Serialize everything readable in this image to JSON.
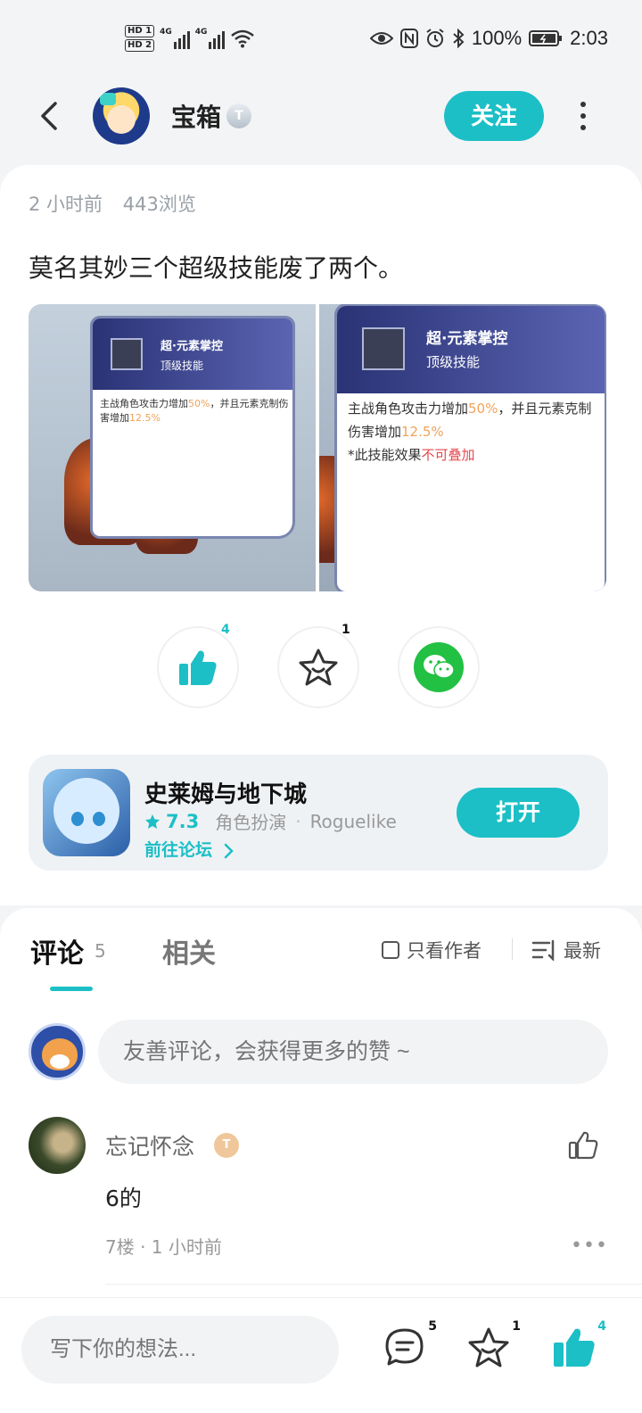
{
  "status_bar": {
    "hd1": "HD 1",
    "hd2": "HD 2",
    "net1": "4G",
    "net2": "4G",
    "battery": "100%",
    "time": "2:03"
  },
  "header": {
    "username": "宝箱",
    "badge": "T",
    "follow_label": "关注"
  },
  "post": {
    "time": "2 小时前",
    "views": "443浏览",
    "text": "莫名其妙三个超级技能废了两个。",
    "image1": {
      "skill_name": "超·元素掌控",
      "skill_tier": "顶级技能",
      "desc_a": "主战角色攻击力增加",
      "desc_b": "50%",
      "desc_c": "，并且元素克制伤害增加",
      "desc_d": "12.5%"
    },
    "image2": {
      "skill_name": "超·元素掌控",
      "skill_tier": "顶级技能",
      "desc_a": "主战角色攻击力增加",
      "desc_b": "50%",
      "desc_c": "，并且元素克制伤害增加",
      "desc_d": "12.5%",
      "note_a": "*此技能效果",
      "note_b": "不可叠加"
    }
  },
  "actions": {
    "like_count": "4",
    "fav_count": "1",
    "wechat_icon": "wechat-icon"
  },
  "game": {
    "title": "史莱姆与地下城",
    "score": "7.3",
    "genre": "角色扮演",
    "tag": "Roguelike",
    "forum_label": "前往论坛",
    "open_label": "打开"
  },
  "comments": {
    "tab_comment": "评论",
    "tab_count": "5",
    "tab_related": "相关",
    "only_author": "只看作者",
    "sort_label": "最新",
    "input_placeholder": "友善评论，会获得更多的赞 ~",
    "items": [
      {
        "author": "忘记怀念",
        "badge": "T",
        "text": "6的",
        "meta": "7楼 · 1 小时前",
        "more": "•••"
      }
    ]
  },
  "bottom_bar": {
    "input_placeholder": "写下你的想法...",
    "comment_count": "5",
    "fav_count": "1",
    "like_count": "4"
  },
  "colors": {
    "accent": "#1cbfc6",
    "wechat": "#22c043",
    "highlight_orange": "#f0a35a",
    "highlight_red": "#e5484d"
  }
}
